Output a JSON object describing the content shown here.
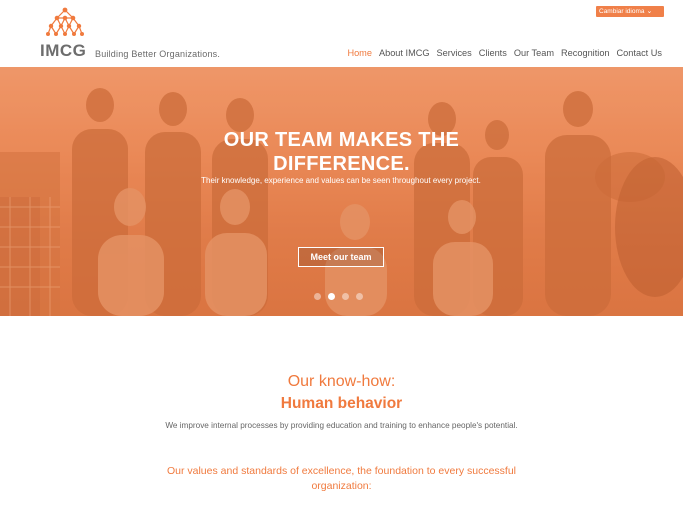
{
  "header": {
    "logo_text": "IMCG",
    "tagline": "Building Better Organizations.",
    "language_button": "Cambiar idioma",
    "nav": [
      {
        "label": "Home",
        "active": true
      },
      {
        "label": "About IMCG",
        "active": false
      },
      {
        "label": "Services",
        "active": false
      },
      {
        "label": "Clients",
        "active": false
      },
      {
        "label": "Our Team",
        "active": false
      },
      {
        "label": "Recognition",
        "active": false
      },
      {
        "label": "Contact Us",
        "active": false
      }
    ]
  },
  "hero": {
    "title_line1": "OUR TEAM MAKES THE",
    "title_line2": "DIFFERENCE.",
    "subtitle": "Their knowledge, experience and values can be seen throughout every project.",
    "button": "Meet our team",
    "slides": 4,
    "active_slide": 2
  },
  "content": {
    "title": "Our know-how:",
    "subtitle": "Human behavior",
    "description": "We improve internal processes by providing education and training to enhance people's potential.",
    "values": "Our values and standards of excellence, the foundation to every successful organization:"
  },
  "colors": {
    "accent": "#f07a3e",
    "hero_overlay": "#e8864f"
  }
}
